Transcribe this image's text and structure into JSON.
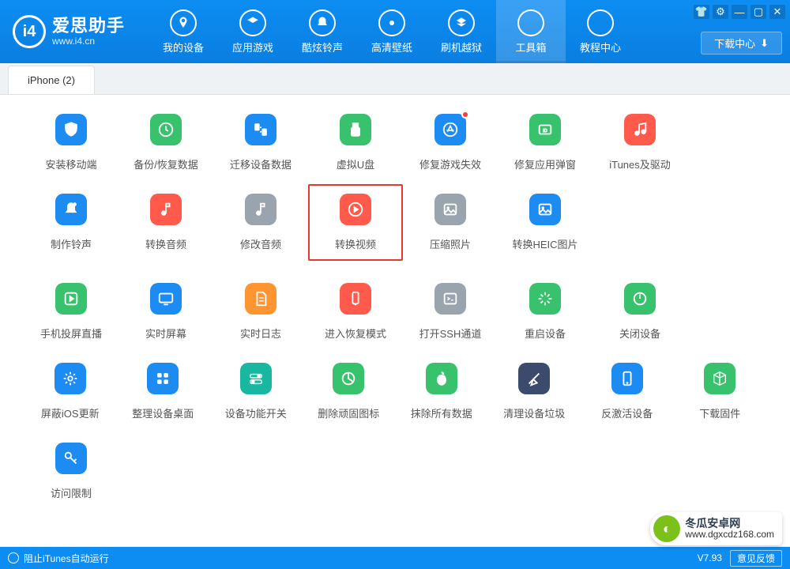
{
  "logo": {
    "cn": "爱思助手",
    "en": "www.i4.cn",
    "mark": "i4"
  },
  "nav": [
    {
      "id": "my-device",
      "label": "我的设备"
    },
    {
      "id": "app-games",
      "label": "应用游戏"
    },
    {
      "id": "ringtones",
      "label": "酷炫铃声"
    },
    {
      "id": "wallpapers",
      "label": "高清壁纸"
    },
    {
      "id": "flash",
      "label": "刷机越狱"
    },
    {
      "id": "toolbox",
      "label": "工具箱",
      "active": true
    },
    {
      "id": "tutorial",
      "label": "教程中心"
    }
  ],
  "winctl": {
    "shirt": "👕",
    "gear": "⚙",
    "min": "—",
    "max": "▢",
    "close": "✕"
  },
  "download_btn": "下载中心",
  "tabs": [
    {
      "id": "iphone",
      "label": "iPhone (2)"
    }
  ],
  "rows": [
    [
      {
        "id": "install-client",
        "label": "安装移动端",
        "col": "c-blue",
        "icon": "shield"
      },
      {
        "id": "backup",
        "label": "备份/恢复数据",
        "col": "c-green",
        "icon": "clock"
      },
      {
        "id": "migrate",
        "label": "迁移设备数据",
        "col": "c-blue",
        "icon": "swap"
      },
      {
        "id": "virtual-udisk",
        "label": "虚拟U盘",
        "col": "c-green",
        "icon": "usb"
      },
      {
        "id": "fix-game",
        "label": "修复游戏失效",
        "col": "c-blue",
        "icon": "appstore",
        "dot": true
      },
      {
        "id": "fix-popup",
        "label": "修复应用弹窗",
        "col": "c-green",
        "icon": "appleid"
      },
      {
        "id": "itunes-driver",
        "label": "iTunes及驱动",
        "col": "c-red",
        "icon": "music"
      }
    ],
    [
      {
        "id": "make-ring",
        "label": "制作铃声",
        "col": "c-blue",
        "icon": "bell"
      },
      {
        "id": "convert-audio",
        "label": "转换音频",
        "col": "c-red",
        "icon": "note"
      },
      {
        "id": "edit-audio",
        "label": "修改音频",
        "col": "c-gray",
        "icon": "note"
      },
      {
        "id": "convert-video",
        "label": "转换视频",
        "col": "c-red",
        "icon": "play",
        "hl": true
      },
      {
        "id": "compress-photo",
        "label": "压缩照片",
        "col": "c-gray",
        "icon": "image"
      },
      {
        "id": "convert-heic",
        "label": "转换HEIC图片",
        "col": "c-blue",
        "icon": "image"
      }
    ],
    [
      {
        "id": "screen-cast",
        "label": "手机投屏直播",
        "col": "c-green",
        "icon": "play2"
      },
      {
        "id": "realtime-screen",
        "label": "实时屏幕",
        "col": "c-blue",
        "icon": "monitor"
      },
      {
        "id": "realtime-log",
        "label": "实时日志",
        "col": "c-orange",
        "icon": "doc"
      },
      {
        "id": "recovery",
        "label": "进入恢复模式",
        "col": "c-red",
        "icon": "phone"
      },
      {
        "id": "ssh",
        "label": "打开SSH通道",
        "col": "c-gray",
        "icon": "terminal"
      },
      {
        "id": "reboot",
        "label": "重启设备",
        "col": "c-green",
        "icon": "spark"
      },
      {
        "id": "shutdown",
        "label": "关闭设备",
        "col": "c-green",
        "icon": "power"
      }
    ],
    [
      {
        "id": "block-ios-update",
        "label": "屏蔽iOS更新",
        "col": "c-blue",
        "icon": "gear"
      },
      {
        "id": "organize-desktop",
        "label": "整理设备桌面",
        "col": "c-blue",
        "icon": "grid"
      },
      {
        "id": "feature-toggle",
        "label": "设备功能开关",
        "col": "c-teal",
        "icon": "toggle"
      },
      {
        "id": "remove-stubborn",
        "label": "删除顽固图标",
        "col": "c-green",
        "icon": "pie"
      },
      {
        "id": "erase-all",
        "label": "抹除所有数据",
        "col": "c-green",
        "icon": "apple"
      },
      {
        "id": "clean-trash",
        "label": "清理设备垃圾",
        "col": "c-navy",
        "icon": "broom"
      },
      {
        "id": "deactivate",
        "label": "反激活设备",
        "col": "c-blue",
        "icon": "device"
      },
      {
        "id": "download-fw",
        "label": "下载固件",
        "col": "c-green",
        "icon": "cube"
      }
    ],
    [
      {
        "id": "access-limit",
        "label": "访问限制",
        "col": "c-blue",
        "icon": "key"
      }
    ]
  ],
  "footer": {
    "block_itunes": "阻止iTunes自动运行",
    "version": "V7.93",
    "feedback": "意见反馈"
  },
  "watermark": {
    "title": "冬瓜安卓网",
    "url": "www.dgxcdz168.com"
  }
}
